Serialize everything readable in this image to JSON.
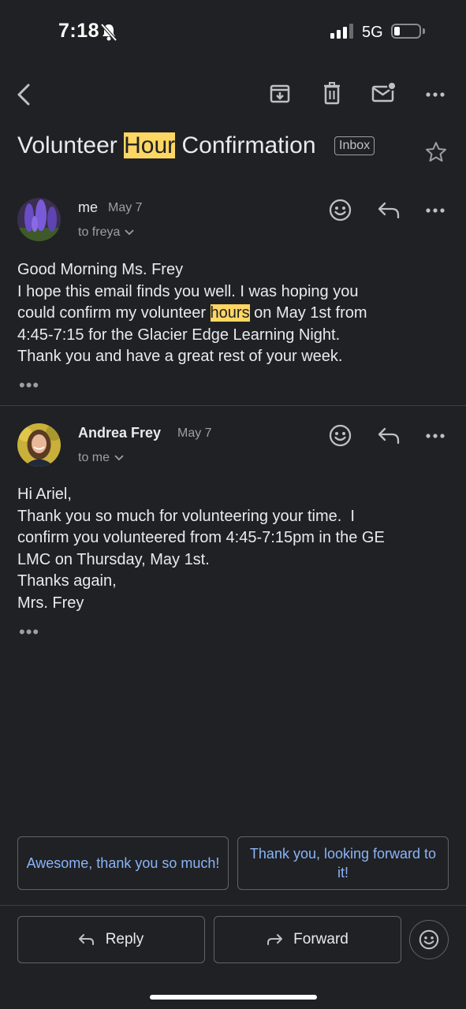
{
  "status_bar": {
    "time": "7:18",
    "network": "5G"
  },
  "toolbar": {
    "back": "back-arrow-icon",
    "archive": "archive-icon",
    "delete": "trash-icon",
    "mark_unread": "mail-unread-icon",
    "more": "more-horizontal-icon"
  },
  "subject": {
    "before": "Volunteer ",
    "highlight": "Hour",
    "after": " Confirmation",
    "label": "Inbox"
  },
  "messages": [
    {
      "sender": "me",
      "date": "May 7",
      "to": "to freya",
      "body": {
        "line1": "Good Morning Ms. Frey",
        "line2": "I hope this email finds you well. I was hoping you",
        "line3_before": "could confirm my volunteer ",
        "line3_highlight": "hours",
        "line3_after": " on May 1st from",
        "line4": "4:45-7:15 for the Glacier Edge Learning Night.",
        "line5": "Thank you and have a great rest of your week."
      },
      "trimmed": "•••"
    },
    {
      "sender": "Andrea Frey",
      "date": "May 7",
      "to": "to me",
      "body": {
        "line1": "Hi Ariel,",
        "line2": "Thank you so much for volunteering your time.  I",
        "line3": "confirm you volunteered from 4:45-7:15pm in the GE",
        "line4": "LMC on Thursday, May 1st.",
        "line5": "Thanks again,",
        "line6": "Mrs. Frey"
      },
      "trimmed": "•••"
    }
  ],
  "smart_replies": [
    "Awesome, thank you so much!",
    "Thank you, looking forward to it!"
  ],
  "actions": {
    "reply": "Reply",
    "forward": "Forward"
  },
  "colors": {
    "background": "#202124",
    "highlight": "#fdd663",
    "link": "#8ab4f8",
    "border": "#5f6368"
  }
}
